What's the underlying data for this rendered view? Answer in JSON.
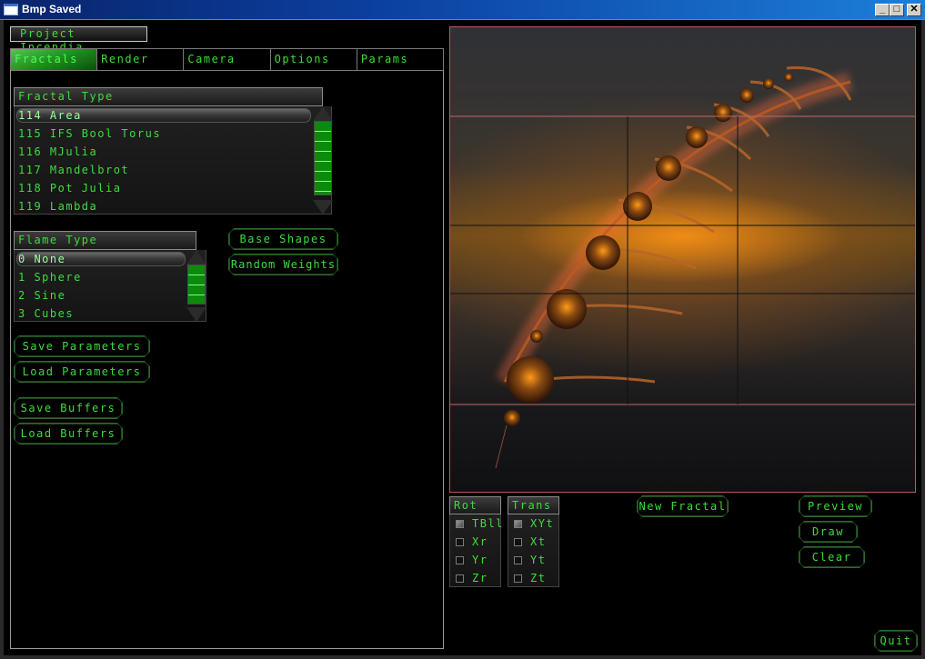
{
  "window": {
    "title": "Bmp Saved",
    "controls": {
      "minimize": "_",
      "maximize": "□",
      "close": "✕"
    }
  },
  "project_label": "Project Incendia",
  "tabs": [
    {
      "label": "Fractals",
      "active": true
    },
    {
      "label": "Render",
      "active": false
    },
    {
      "label": "Camera",
      "active": false
    },
    {
      "label": "Options",
      "active": false
    },
    {
      "label": "Params",
      "active": false
    }
  ],
  "fractal_type": {
    "header": "Fractal Type",
    "items": [
      {
        "label": "114 Area",
        "selected": true
      },
      {
        "label": "115 IFS Bool Torus",
        "selected": false
      },
      {
        "label": "116 MJulia",
        "selected": false
      },
      {
        "label": "117 Mandelbrot",
        "selected": false
      },
      {
        "label": "118 Pot Julia",
        "selected": false
      },
      {
        "label": "119 Lambda",
        "selected": false
      }
    ]
  },
  "flame_type": {
    "header": "Flame Type",
    "items": [
      {
        "label": "0 None",
        "selected": true
      },
      {
        "label": "1 Sphere",
        "selected": false
      },
      {
        "label": "2 Sine",
        "selected": false
      },
      {
        "label": "3 Cubes",
        "selected": false
      }
    ]
  },
  "buttons": {
    "base_shapes": "Base Shapes",
    "random_weights": "Random Weights",
    "save_parameters": "Save Parameters",
    "load_parameters": "Load Parameters",
    "save_buffers": "Save Buffers",
    "load_buffers": "Load Buffers",
    "new_fractal": "New Fractal",
    "preview": "Preview",
    "draw": "Draw",
    "clear": "Clear",
    "quit": "Quit"
  },
  "rot_group": {
    "header": "Rot",
    "items": [
      {
        "label": "TBll",
        "checked": true
      },
      {
        "label": "Xr",
        "checked": false
      },
      {
        "label": "Yr",
        "checked": false
      },
      {
        "label": "Zr",
        "checked": false
      }
    ]
  },
  "trans_group": {
    "header": "Trans",
    "items": [
      {
        "label": "XYt",
        "checked": true
      },
      {
        "label": "Xt",
        "checked": false
      },
      {
        "label": "Yt",
        "checked": false
      },
      {
        "label": "Zt",
        "checked": false
      }
    ]
  },
  "render_preview": {
    "description": "Orange fern fractal with spheres on sunset background",
    "colors": {
      "glow": "#ff9a1a",
      "grid_red": "#c06a6a",
      "grid_dark": "#111111"
    }
  }
}
